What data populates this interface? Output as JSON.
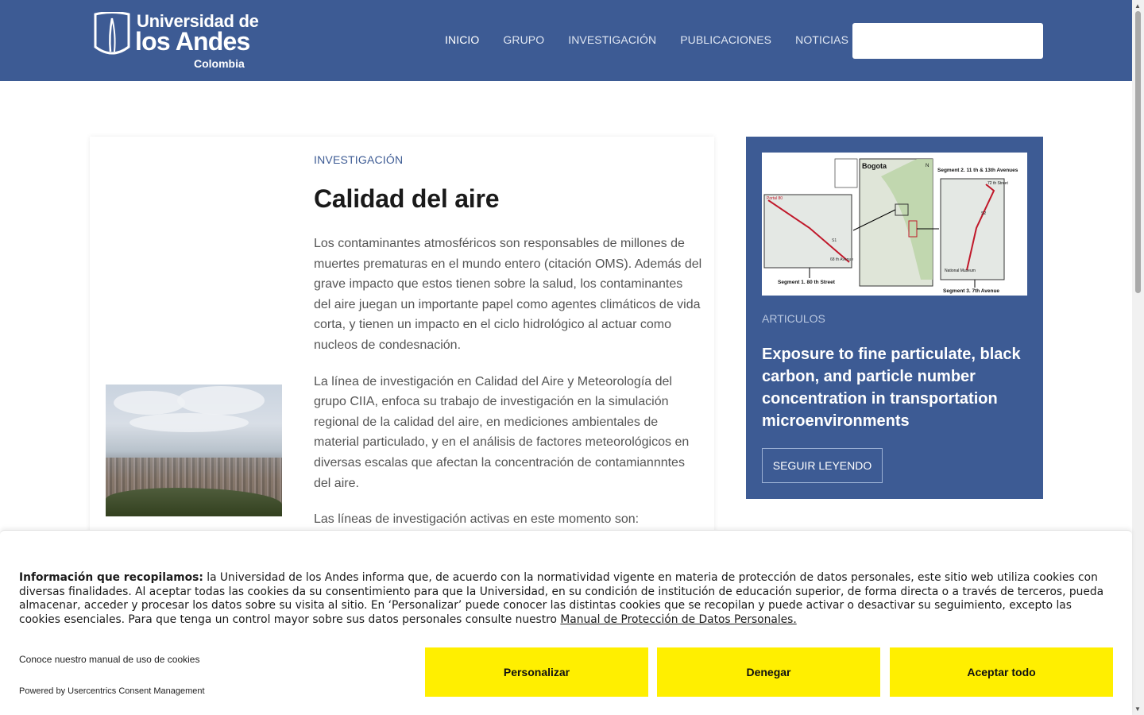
{
  "header": {
    "logo": {
      "line1": "Universidad de",
      "line2": "los Andes",
      "line3": "Colombia"
    },
    "nav": [
      {
        "label": "INICIO",
        "active": true
      },
      {
        "label": "GRUPO",
        "active": false
      },
      {
        "label": "INVESTIGACIÓN",
        "active": false
      },
      {
        "label": "PUBLICACIONES",
        "active": false
      },
      {
        "label": "NOTICIAS",
        "active": false
      }
    ],
    "search": {
      "placeholder": ""
    },
    "background_color": "#3d5b94"
  },
  "main": {
    "category": "INVESTIGACIÓN",
    "title": "Calidad del aire",
    "paragraphs": [
      "Los contaminantes atmosféricos son responsables de millones de muertes prematuras en el mundo entero (citación OMS). Además del grave impacto que estos tienen sobre la salud, los contaminantes del aire juegan un importante papel como agentes climáticos de vida corta, y tienen un impacto en el ciclo hidrológico al actuar como nucleos de condesnación.",
      "La línea de investigación en Calidad del Aire y Meteorología del grupo CIIA, enfoca su trabajo de investigación en la simulación regional de la calidad del aire, en mediciones ambientales de material particulado, y en el análisis de factores meteorológicos en diversas escalas que afectan la concentración de contamiannntes del aire.",
      "Las líneas de investigación activas en este momento son:"
    ]
  },
  "sidebar": {
    "map": {
      "title": "Bogota",
      "segment1": "Segment 1. 80 th Street",
      "segment2": "Segment 2. 11 th & 13th Avenues",
      "segment3": "Segment 3. 7th Avenue",
      "label_portal": "Portal 80",
      "label_68": "68 th Avenue",
      "label_72": "72 th Street",
      "label_museum": "National Museum",
      "label_s1": "S1",
      "label_s2": "S2",
      "label_n": "N"
    },
    "category": "ARTICULOS",
    "title": "Exposure to fine particulate, black carbon, and particle number concentration in transportation microenvironments",
    "button": "SEGUIR LEYENDO"
  },
  "cookie": {
    "heading": "Información que recopilamos:",
    "text": " la Universidad de los Andes informa que, de acuerdo con la normatividad vigente en materia de protección de datos personales, este sitio web utiliza cookies con diversas finalidades. Al aceptar todas las cookies da su consentimiento para que la Universidad, en su condición de institución de educación superior, de forma directa o a través de terceros, pueda almacenar, acceder y procesar los datos sobre su visita al sitio. En ‘Personalizar’ puede conocer las distintas cookies que se recopilan y puede activar o desactivar su seguimiento, excepto las cookies esenciales. Para que tenga un control mayor sobre sus datos personales consulte nuestro ",
    "link": "Manual de Protección de Datos Personales.",
    "manual_link": "Conoce nuestro manual de uso de cookies",
    "powered": "Powered by Usercentrics Consent Management",
    "buttons": {
      "customize": "Personalizar",
      "deny": "Denegar",
      "accept": "Aceptar todo"
    },
    "button_color": "#ffef00"
  }
}
